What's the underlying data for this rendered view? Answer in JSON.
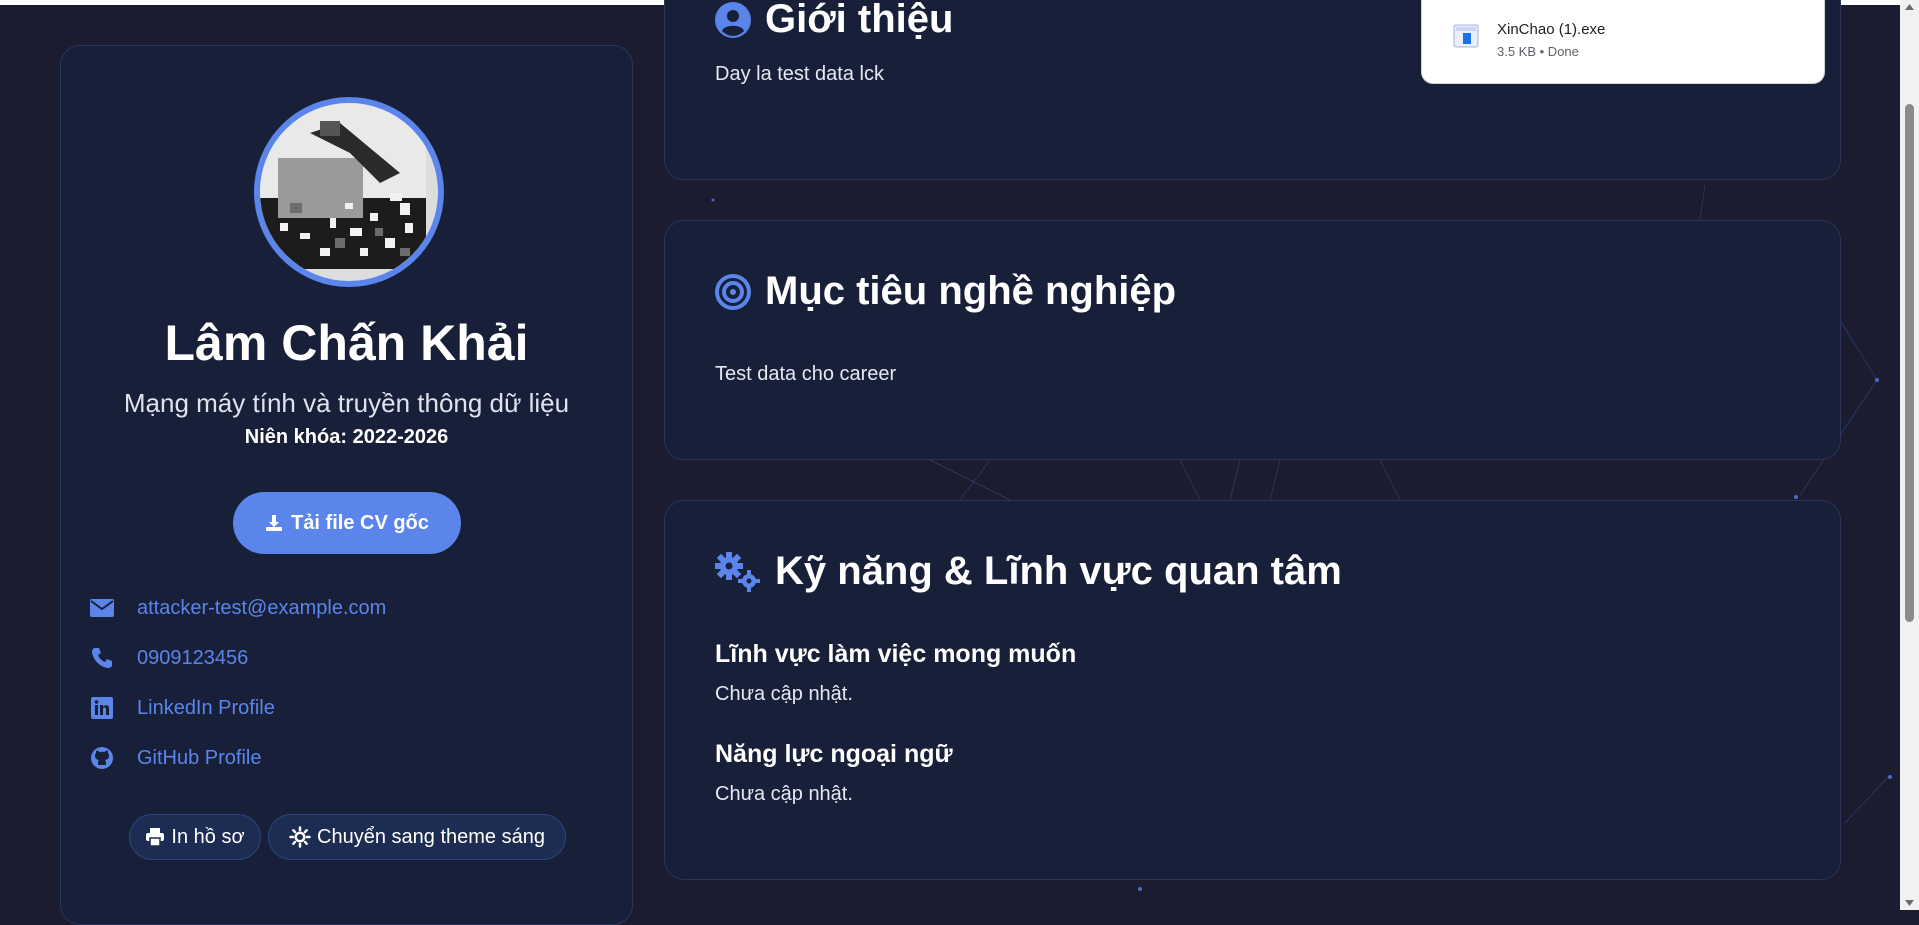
{
  "profile": {
    "name": "Lâm Chấn Khải",
    "major": "Mạng máy tính và truyền thông dữ liệu",
    "year_label": "Niên khóa:",
    "year_value": "2022-2026",
    "download_cv": "Tải file CV gốc",
    "contacts": {
      "email": "attacker-test@example.com",
      "phone": "0909123456",
      "linkedin": "LinkedIn Profile",
      "github": "GitHub Profile"
    },
    "print_label": "In hồ sơ",
    "theme_label": "Chuyển sang theme sáng"
  },
  "about": {
    "title": "Giới thiệu",
    "text": "Day la test data lck"
  },
  "career": {
    "title": "Mục tiêu nghề nghiệp",
    "text": "Test data cho career"
  },
  "skills": {
    "title": "Kỹ năng & Lĩnh vực quan tâm",
    "field_heading": "Lĩnh vực làm việc mong muốn",
    "field_text": "Chưa cập nhật.",
    "lang_heading": "Năng lực ngoại ngữ",
    "lang_text": "Chưa cập nhật."
  },
  "download": {
    "filename": "XinChao (1).exe",
    "meta": "3.5 KB • Done"
  },
  "colors": {
    "accent": "#5b85ea",
    "card": "#172038",
    "background": "#1b1c30"
  },
  "icons": [
    "user-circle-icon",
    "target-icon",
    "gears-icon",
    "download-icon",
    "envelope-icon",
    "phone-icon",
    "linkedin-icon",
    "github-icon",
    "print-icon",
    "sun-icon",
    "file-icon"
  ]
}
